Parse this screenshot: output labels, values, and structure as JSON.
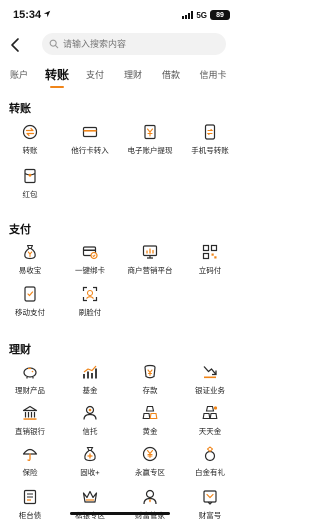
{
  "status": {
    "time": "15:34",
    "network": "5G",
    "battery": "89"
  },
  "search": {
    "placeholder": "请输入搜索内容"
  },
  "tabs": [
    {
      "label": "账户"
    },
    {
      "label": "转账"
    },
    {
      "label": "支付"
    },
    {
      "label": "理财"
    },
    {
      "label": "借款"
    },
    {
      "label": "信用卡"
    }
  ],
  "active_tab": "转账",
  "sections": {
    "transfer": {
      "title": "转账",
      "items": [
        "转账",
        "他行卡转入",
        "电子账户提现",
        "手机号转账",
        "红包"
      ]
    },
    "payment": {
      "title": "支付",
      "items": [
        "易收宝",
        "一键绑卡",
        "商户营销平台",
        "立码付",
        "移动支付",
        "刷脸付"
      ]
    },
    "wealth": {
      "title": "理财",
      "items": [
        "理财产品",
        "基金",
        "存款",
        "银证业务",
        "直销银行",
        "信托",
        "黄金",
        "天天金",
        "保险",
        "固收+",
        "永赢专区",
        "白金有礼",
        "柜台债",
        "私银专区",
        "财富管家",
        "财富号"
      ]
    }
  },
  "colors": {
    "accent": "#f08519",
    "icon": "#2b2b2b"
  }
}
